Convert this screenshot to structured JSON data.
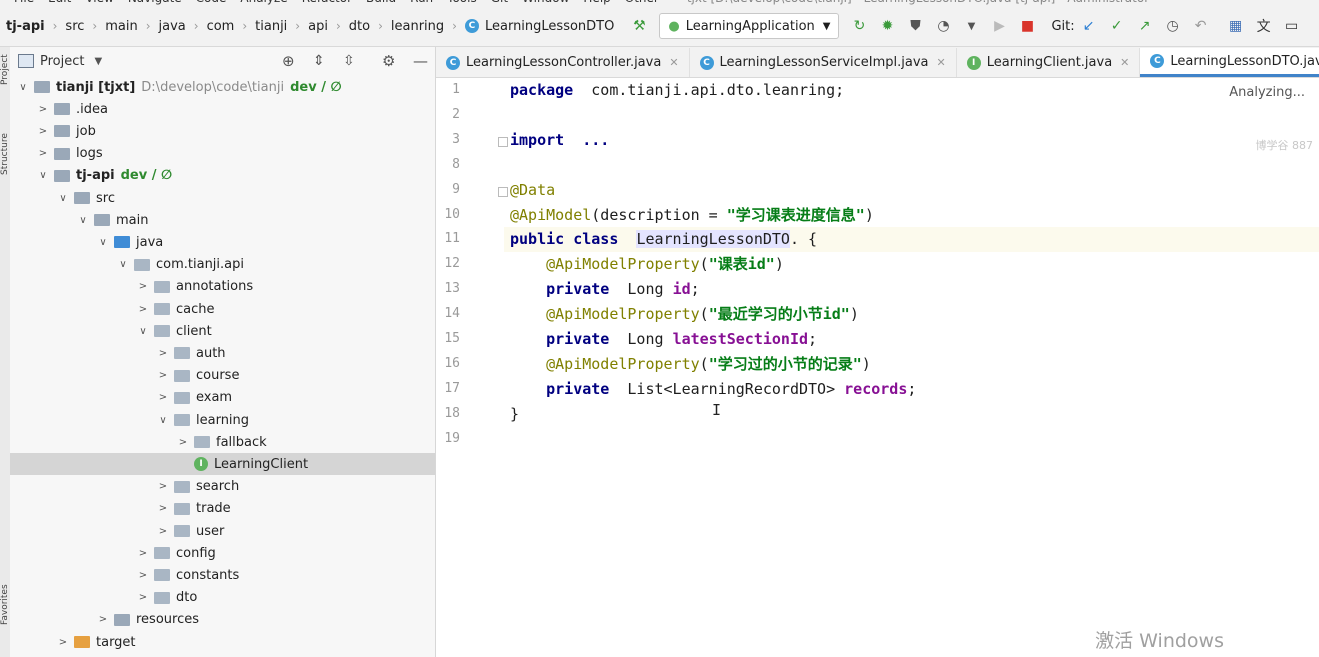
{
  "menu": {
    "items": [
      "File",
      "Edit",
      "View",
      "Navigate",
      "Code",
      "Analyze",
      "Refactor",
      "Build",
      "Run",
      "Tools",
      "Git",
      "Window",
      "Help",
      "Other"
    ],
    "window_title": "tjxt [D:\\develop\\code\\tianji] - LearningLessonDTO.java [tj-api] - Administrator"
  },
  "breadcrumb": [
    "tj-api",
    "src",
    "main",
    "java",
    "com",
    "tianji",
    "api",
    "dto",
    "leanring",
    "LearningLessonDTO"
  ],
  "toolbar": {
    "run_config": "LearningApplication",
    "git_label": "Git:"
  },
  "project_panel": {
    "title": "Project",
    "tree": [
      {
        "label": "tianji [tjxt]",
        "extra": "D:\\develop\\code\\tianji",
        "git": "dev / ∅",
        "depth": 0,
        "arrow": "∨",
        "icon": "folder",
        "bold": true
      },
      {
        "label": ".idea",
        "depth": 1,
        "arrow": ">",
        "icon": "folder"
      },
      {
        "label": "job",
        "depth": 1,
        "arrow": ">",
        "icon": "folder"
      },
      {
        "label": "logs",
        "depth": 1,
        "arrow": ">",
        "icon": "folder"
      },
      {
        "label": "tj-api",
        "git": "dev / ∅",
        "depth": 1,
        "arrow": "∨",
        "icon": "folder",
        "bold": true
      },
      {
        "label": "src",
        "depth": 2,
        "arrow": "∨",
        "icon": "folder"
      },
      {
        "label": "main",
        "depth": 3,
        "arrow": "∨",
        "icon": "folder"
      },
      {
        "label": "java",
        "depth": 4,
        "arrow": "∨",
        "icon": "blue"
      },
      {
        "label": "com.tianji.api",
        "depth": 5,
        "arrow": "∨",
        "icon": "pkg"
      },
      {
        "label": "annotations",
        "depth": 6,
        "arrow": ">",
        "icon": "pkg"
      },
      {
        "label": "cache",
        "depth": 6,
        "arrow": ">",
        "icon": "pkg"
      },
      {
        "label": "client",
        "depth": 6,
        "arrow": "∨",
        "icon": "pkg"
      },
      {
        "label": "auth",
        "depth": 7,
        "arrow": ">",
        "icon": "pkg"
      },
      {
        "label": "course",
        "depth": 7,
        "arrow": ">",
        "icon": "pkg"
      },
      {
        "label": "exam",
        "depth": 7,
        "arrow": ">",
        "icon": "pkg"
      },
      {
        "label": "learning",
        "depth": 7,
        "arrow": "∨",
        "icon": "pkg"
      },
      {
        "label": "fallback",
        "depth": 8,
        "arrow": ">",
        "icon": "pkg"
      },
      {
        "label": "LearningClient",
        "depth": 8,
        "arrow": "",
        "icon": "interface",
        "selected": true
      },
      {
        "label": "search",
        "depth": 7,
        "arrow": ">",
        "icon": "pkg"
      },
      {
        "label": "trade",
        "depth": 7,
        "arrow": ">",
        "icon": "pkg"
      },
      {
        "label": "user",
        "depth": 7,
        "arrow": ">",
        "icon": "pkg"
      },
      {
        "label": "config",
        "depth": 6,
        "arrow": ">",
        "icon": "pkg"
      },
      {
        "label": "constants",
        "depth": 6,
        "arrow": ">",
        "icon": "pkg"
      },
      {
        "label": "dto",
        "depth": 6,
        "arrow": ">",
        "icon": "pkg"
      },
      {
        "label": "resources",
        "depth": 4,
        "arrow": ">",
        "icon": "folder"
      },
      {
        "label": "target",
        "depth": 2,
        "arrow": ">",
        "icon": "orange"
      }
    ]
  },
  "left_strip": {
    "top_label": "Project",
    "mid_label": "Structure",
    "bottom_label": "Favorites"
  },
  "editor": {
    "tabs": [
      {
        "label": "LearningLessonController.java",
        "icon": "C"
      },
      {
        "label": "LearningLessonServiceImpl.java",
        "icon": "C"
      },
      {
        "label": "LearningClient.java",
        "icon": "I"
      },
      {
        "label": "LearningLessonDTO.java",
        "icon": "C",
        "active": true
      }
    ],
    "status": "Analyzing...",
    "watermark": "博学谷 887",
    "line_numbers": [
      "1",
      "2",
      "3",
      "8",
      "9",
      "10",
      "11",
      "12",
      "13",
      "14",
      "15",
      "16",
      "17",
      "18",
      "19"
    ],
    "lines": [
      [
        [
          "kw",
          "package"
        ],
        [
          "",
          "  com.tianji.api.dto.leanring;"
        ]
      ],
      [],
      [
        [
          "kw",
          "import"
        ],
        [
          "",
          "  "
        ],
        [
          "kw",
          "..."
        ]
      ],
      [],
      [
        [
          "ann",
          "@Data"
        ]
      ],
      [
        [
          "ann",
          "@ApiModel"
        ],
        [
          "",
          "(description = "
        ],
        [
          "str",
          "\"学习课表进度信息\""
        ],
        [
          "",
          ")"
        ]
      ],
      [
        [
          "kw",
          "public class"
        ],
        [
          "",
          "  "
        ],
        [
          "hl",
          "LearningLessonDTO"
        ],
        [
          "",
          ". {"
        ]
      ],
      [
        [
          "",
          "    "
        ],
        [
          "ann",
          "@ApiModelProperty"
        ],
        [
          "",
          "("
        ],
        [
          "str",
          "\"课表id\""
        ],
        [
          "",
          ")"
        ]
      ],
      [
        [
          "",
          "    "
        ],
        [
          "kw",
          "private"
        ],
        [
          "",
          "  Long "
        ],
        [
          "fld",
          "id"
        ],
        [
          "",
          ";"
        ]
      ],
      [
        [
          "",
          "    "
        ],
        [
          "ann",
          "@ApiModelProperty"
        ],
        [
          "",
          "("
        ],
        [
          "str",
          "\"最近学习的小节id\""
        ],
        [
          "",
          ")"
        ]
      ],
      [
        [
          "",
          "    "
        ],
        [
          "kw",
          "private"
        ],
        [
          "",
          "  Long "
        ],
        [
          "fld",
          "latestSectionId"
        ],
        [
          "",
          ";"
        ]
      ],
      [
        [
          "",
          "    "
        ],
        [
          "ann",
          "@ApiModelProperty"
        ],
        [
          "",
          "("
        ],
        [
          "str",
          "\"学习过的小节的记录\""
        ],
        [
          "",
          ")"
        ]
      ],
      [
        [
          "",
          "    "
        ],
        [
          "kw",
          "private"
        ],
        [
          "",
          "  List<LearningRecordDTO> "
        ],
        [
          "fld",
          "records"
        ],
        [
          "",
          ";"
        ]
      ],
      [
        [
          "",
          "}"
        ]
      ],
      []
    ]
  },
  "os_watermark": "激活 Windows"
}
